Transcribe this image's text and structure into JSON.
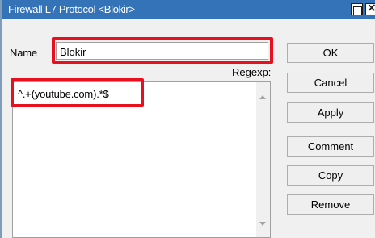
{
  "window": {
    "title": "Firewall L7 Protocol <Blokir>"
  },
  "form": {
    "name_label": "Name",
    "name_value": "Blokir",
    "regexp_label": "Regexp:",
    "regexp_value": "^.+(youtube.com).*$"
  },
  "buttons": {
    "ok": "OK",
    "cancel": "Cancel",
    "apply": "Apply",
    "comment": "Comment",
    "copy": "Copy",
    "remove": "Remove"
  },
  "colors": {
    "titlebar": "#3573b8",
    "highlight": "#e8101f"
  }
}
